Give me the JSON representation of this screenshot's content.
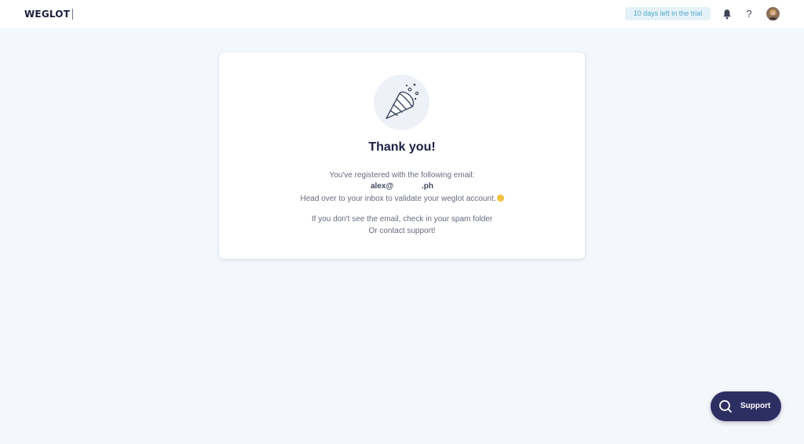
{
  "header": {
    "logo_text": "WEGLOT",
    "trial_badge": "10 days left in the trial",
    "help_glyph": "?",
    "icons": [
      "bell-icon",
      "help-icon",
      "user-avatar"
    ]
  },
  "card": {
    "illustration": "party-popper-icon",
    "title": "Thank you!",
    "registered_line": "You've registered with the following email:",
    "email_user": "alex@",
    "email_domain": ".ph",
    "validate_line": "Head over to your inbox to validate your weglot account.",
    "emoji": "smiling-face-emoji",
    "spam_line": "If you don't see the email, check in your spam folder",
    "contact_line": "Or contact support!"
  },
  "support": {
    "label": "Support",
    "icon": "search-chat-icon"
  },
  "colors": {
    "background": "#f4f7fb",
    "brand_dark": "#2d2f63",
    "badge_bg": "#e4f2f8",
    "badge_text": "#57a9c9",
    "title": "#1e2043"
  }
}
